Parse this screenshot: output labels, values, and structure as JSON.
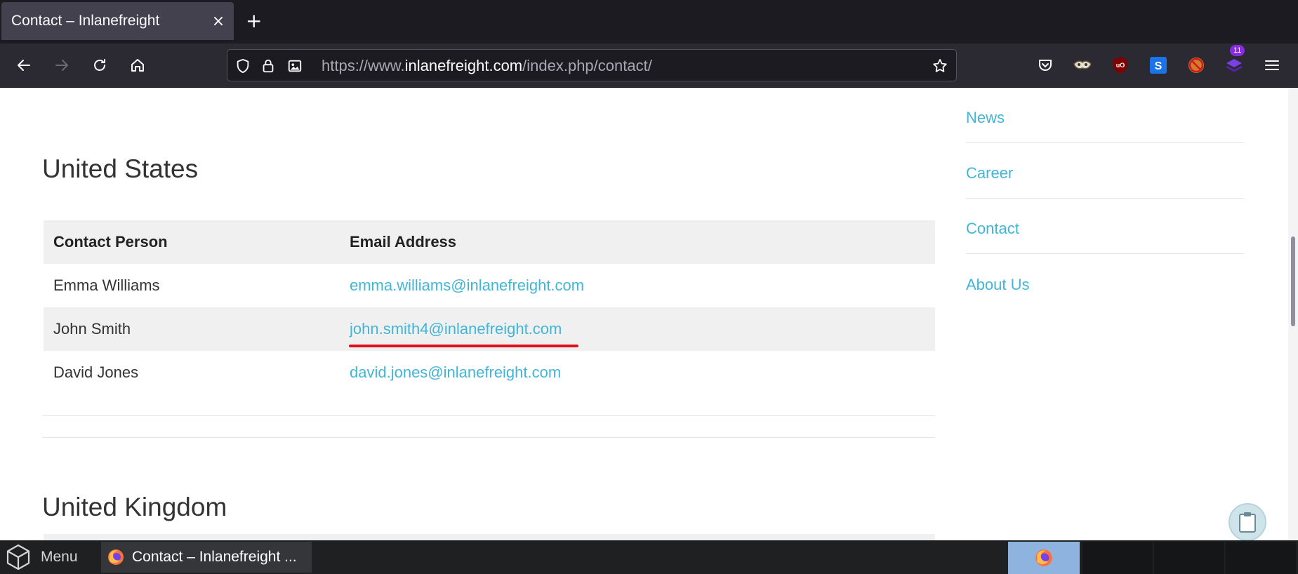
{
  "browser": {
    "tab": {
      "title": "Contact – Inlanefreight",
      "close_icon": "×"
    },
    "new_tab_icon": "+",
    "url": {
      "scheme": "https://www.",
      "host": "inlanefreight.com",
      "path": "/index.php/contact/"
    },
    "extensions_badge": "11"
  },
  "content": {
    "sections": [
      {
        "title": "United States",
        "table": {
          "headers": [
            "Contact Person",
            "Email Address"
          ],
          "rows": [
            {
              "name": "Emma Williams",
              "email": "emma.williams@inlanefreight.com"
            },
            {
              "name": "John Smith",
              "email": "john.smith4@inlanefreight.com"
            },
            {
              "name": "David Jones",
              "email": "david.jones@inlanefreight.com"
            }
          ]
        }
      },
      {
        "title": "United Kingdom"
      }
    ],
    "sidebar": {
      "items": [
        {
          "label": "News"
        },
        {
          "label": "Career"
        },
        {
          "label": "Contact"
        },
        {
          "label": "About Us"
        }
      ]
    }
  },
  "taskbar": {
    "menu_label": "Menu",
    "active_window_label": "Contact – Inlanefreight ..."
  },
  "colors": {
    "link": "#41b6d6",
    "highlight_underline": "#e10f1a",
    "tab_bar": "#1c1b22",
    "nav_bar": "#2b2a33"
  }
}
